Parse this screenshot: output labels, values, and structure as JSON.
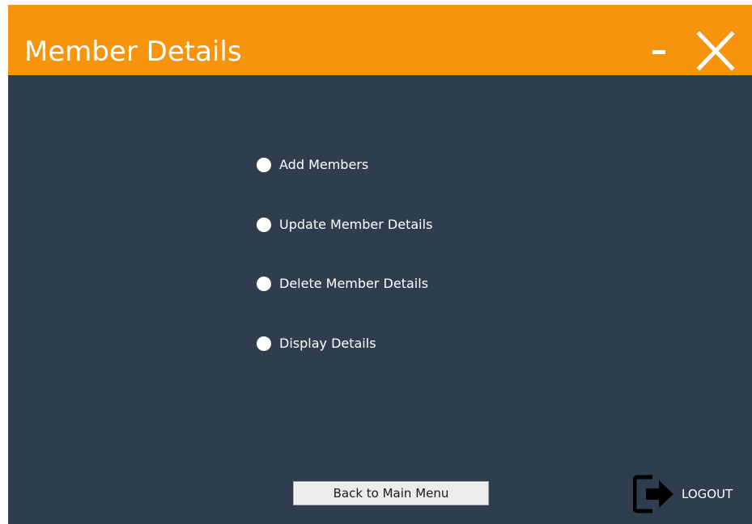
{
  "window": {
    "title": "Member Details",
    "minimize_label": "-",
    "close_label": "X"
  },
  "colors": {
    "titlebar": "#f7930c",
    "background": "#2f3e4f",
    "text": "#ffffff",
    "button_face": "#ececec"
  },
  "menu": {
    "options": [
      {
        "label": "Add Members",
        "selected": false
      },
      {
        "label": "Update Member Details",
        "selected": false
      },
      {
        "label": "Delete Member Details",
        "selected": false
      },
      {
        "label": "Display Details",
        "selected": false
      }
    ]
  },
  "footer": {
    "back_label": "Back to Main Menu",
    "logout_label": "LOGOUT",
    "logout_icon": "logout-icon"
  }
}
